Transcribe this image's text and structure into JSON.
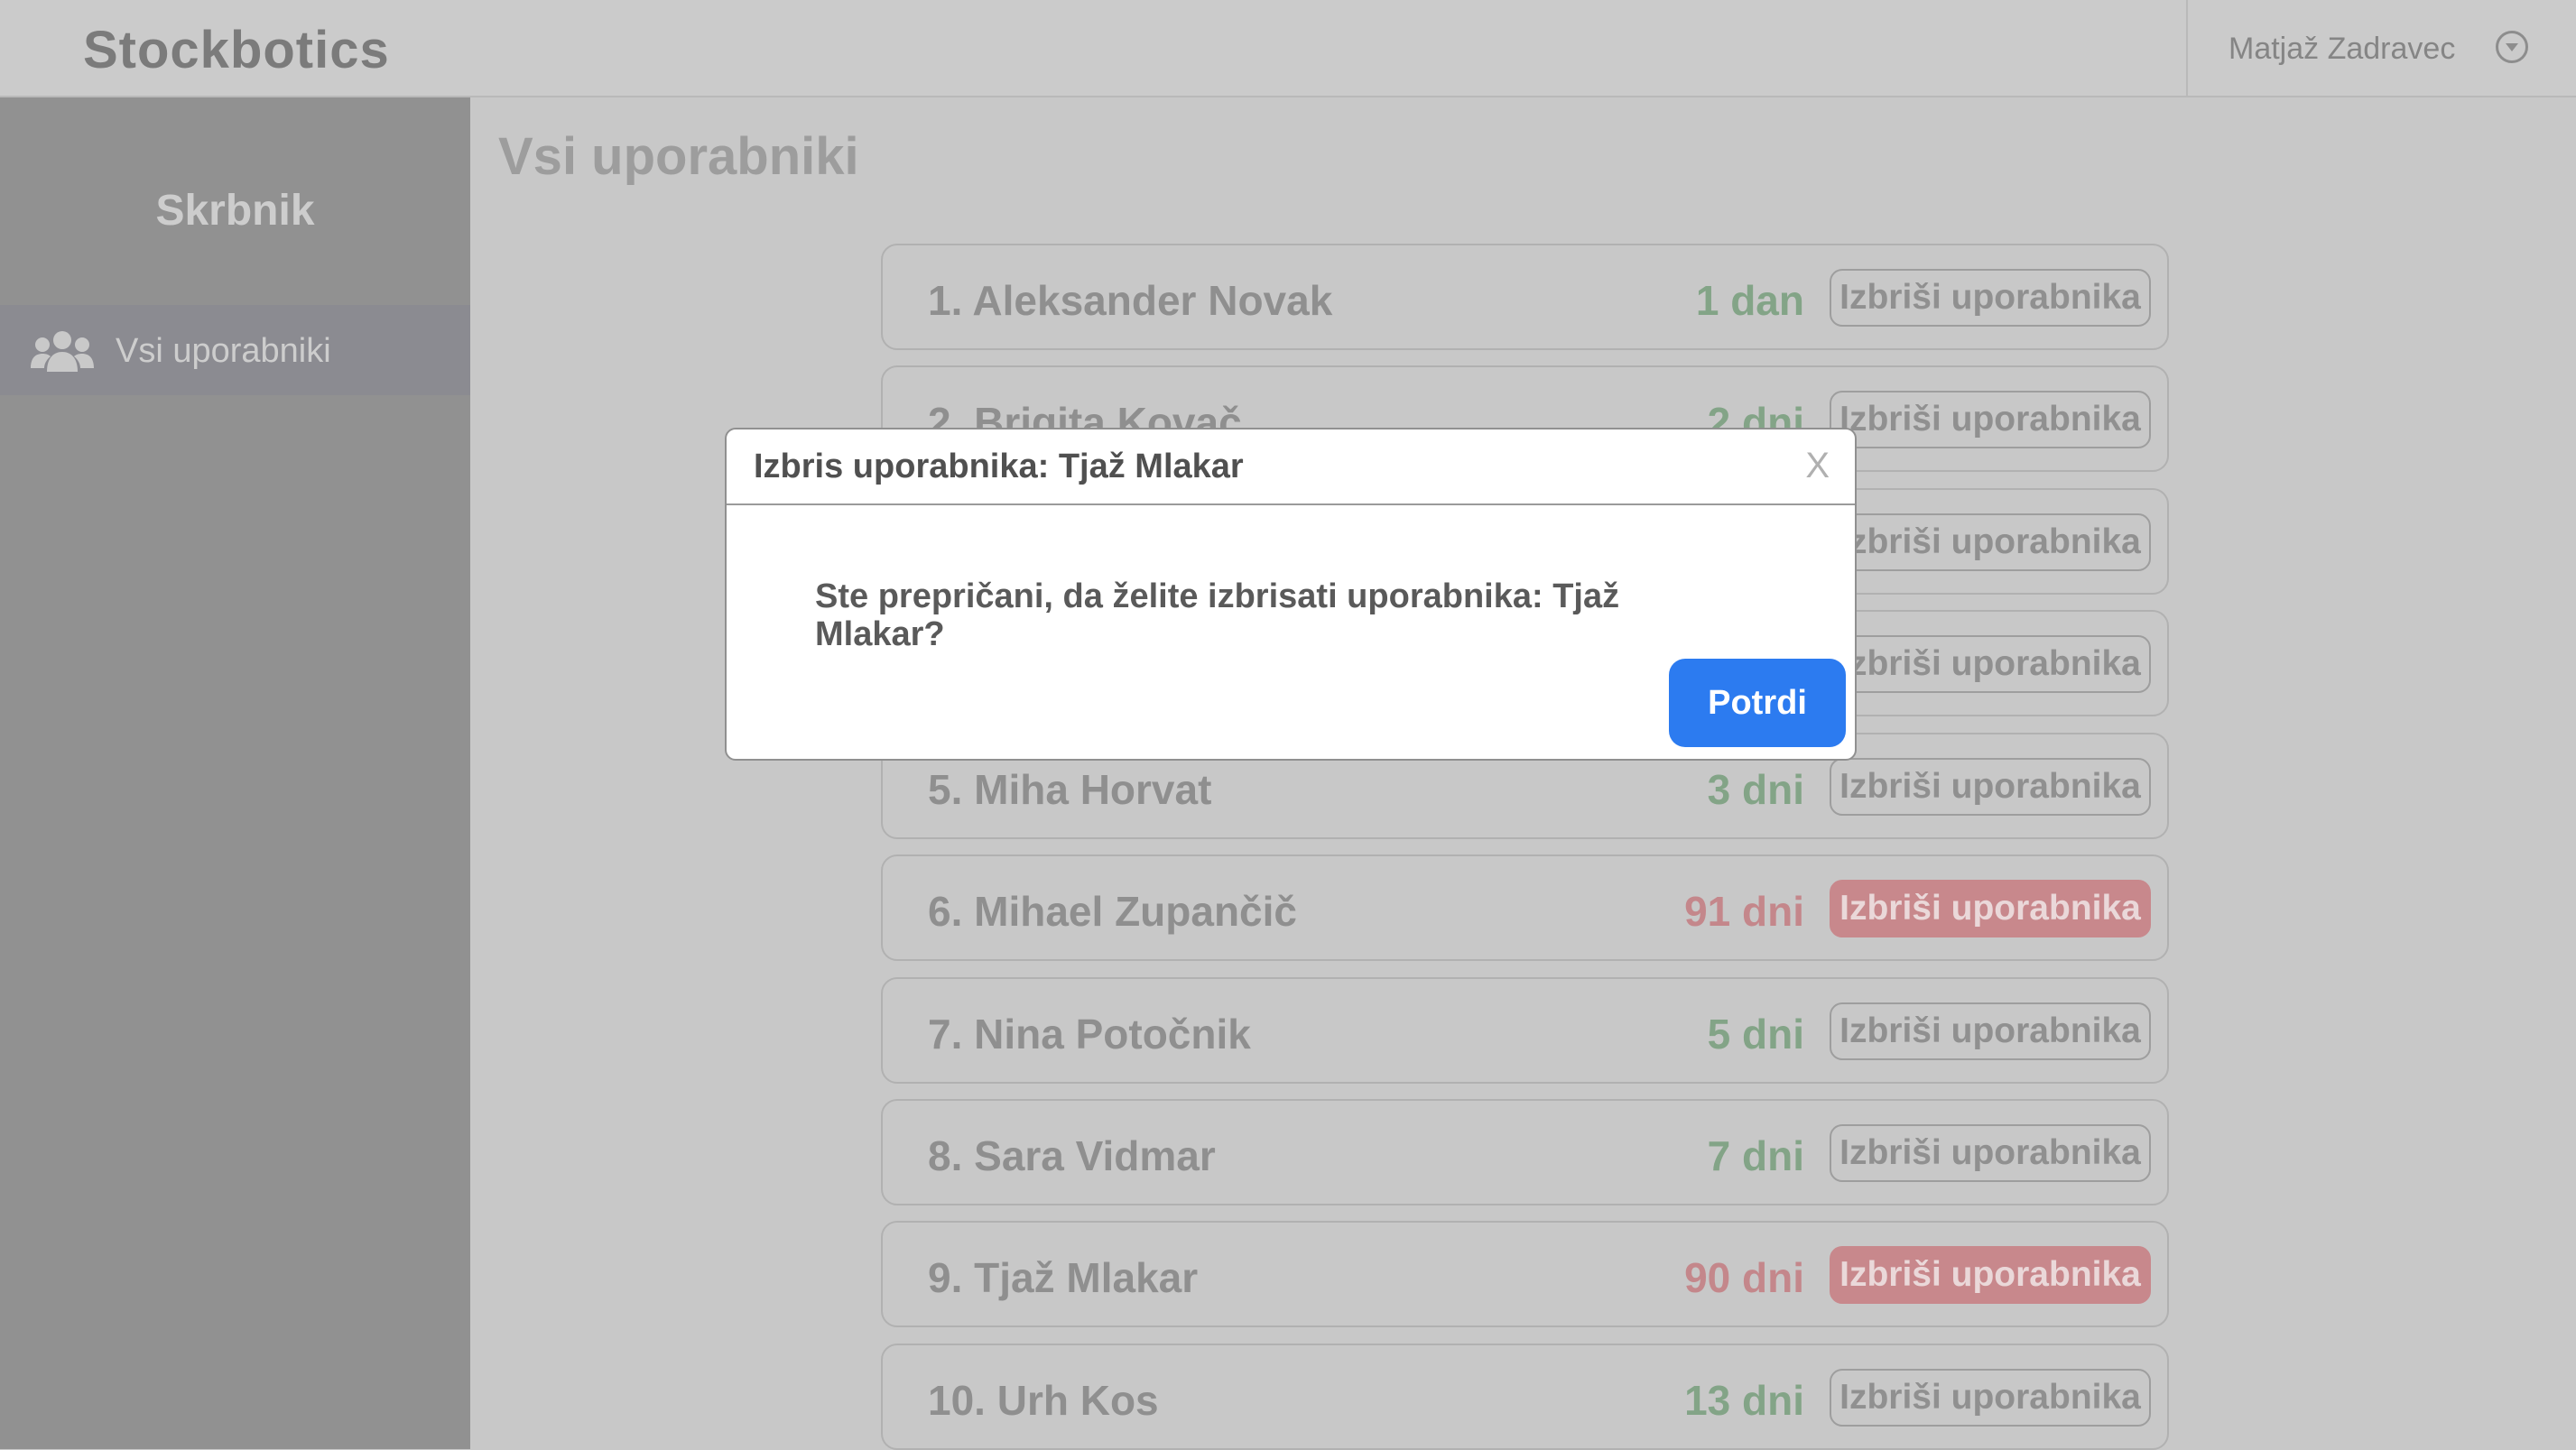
{
  "app": {
    "title": "Stockbotics"
  },
  "user": {
    "name": "Matjaž Zadravec"
  },
  "sidebar": {
    "title": "Skrbnik",
    "items": [
      {
        "label": "Vsi uporabniki",
        "icon": "users-icon"
      }
    ]
  },
  "main": {
    "title": "Vsi uporabniki",
    "rows": [
      {
        "name": "1. Aleksander Novak",
        "days": "1 dan",
        "status": "ok",
        "button": "Izbriši uporabnika"
      },
      {
        "name": "2. Brigita Kovač",
        "days": "2 dni",
        "status": "ok",
        "button": "Izbriši uporabnika"
      },
      {
        "name": "",
        "days": "",
        "status": "ok",
        "button": "Izbriši uporabnika"
      },
      {
        "name": "",
        "days": "",
        "status": "ok",
        "button": "Izbriši uporabnika"
      },
      {
        "name": "5. Miha Horvat",
        "days": "3 dni",
        "status": "ok",
        "button": "Izbriši uporabnika"
      },
      {
        "name": "6. Mihael Zupančič",
        "days": "91 dni",
        "status": "warn",
        "button": "Izbriši uporabnika"
      },
      {
        "name": "7. Nina Potočnik",
        "days": "5 dni",
        "status": "ok",
        "button": "Izbriši uporabnika"
      },
      {
        "name": "8. Sara Vidmar",
        "days": "7 dni",
        "status": "ok",
        "button": "Izbriši uporabnika"
      },
      {
        "name": "9. Tjaž Mlakar",
        "days": "90 dni",
        "status": "warn",
        "button": "Izbriši uporabnika"
      },
      {
        "name": "10. Urh Kos",
        "days": "13 dni",
        "status": "ok",
        "button": "Izbriši uporabnika"
      }
    ]
  },
  "modal": {
    "title": "Izbris uporabnika: Tjaž Mlakar",
    "close": "X",
    "message": "Ste prepričani, da želite izbrisati uporabnika: Tjaž Mlakar?",
    "confirm": "Potrdi"
  },
  "colors": {
    "ok_days": "#83a487",
    "warn_days": "#c4878b",
    "danger_button": "#c8888c",
    "confirm_button": "#2c7bf0"
  }
}
